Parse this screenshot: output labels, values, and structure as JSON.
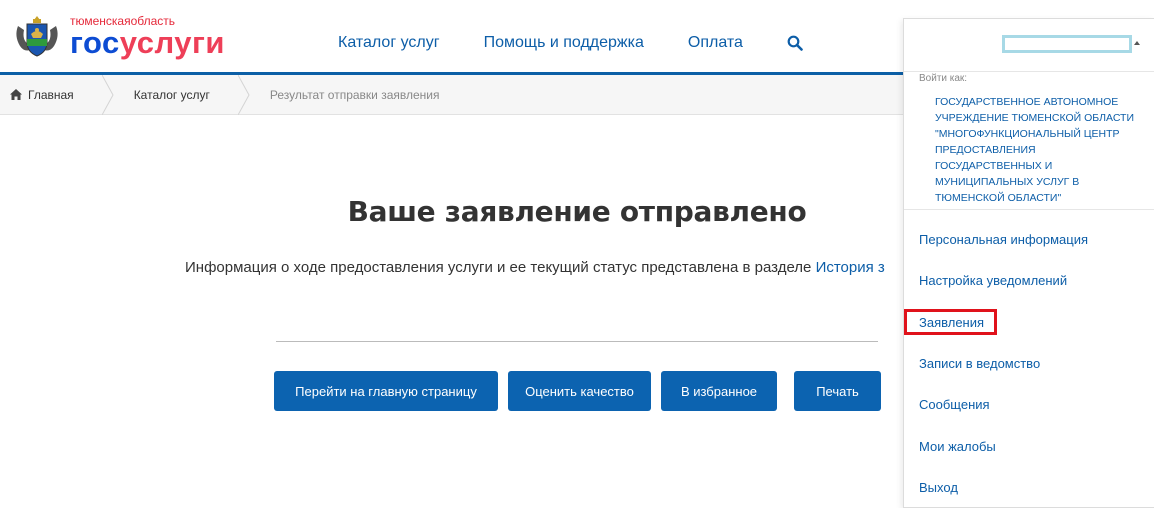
{
  "header": {
    "logo_region": "тюменскаяобласть",
    "logo_region_a": "тюменская",
    "logo_region_b": "область",
    "logo_main_a": "гос",
    "logo_main_b": "услуги",
    "nav": [
      "Каталог услуг",
      "Помощь и поддержка",
      "Оплата"
    ],
    "search_icon": "search-icon"
  },
  "breadcrumb": {
    "home": "Главная",
    "catalog": "Каталог услуг",
    "current": "Результат отправки заявления"
  },
  "main": {
    "title": "Ваше заявление отправлено",
    "info_text": "Информация о ходе предоставления услуги и ее текущий статус представлена в разделе ",
    "info_link": "История з",
    "buttons": {
      "home": "Перейти на главную страницу",
      "rate": "Оценить качество",
      "favorite": "В избранное",
      "print": "Печать"
    }
  },
  "user_menu": {
    "user_name_redacted": "",
    "login_as_label": "Войти как:",
    "organization": "ГОСУДАРСТВЕННОЕ АВТОНОМНОЕ УЧРЕЖДЕНИЕ ТЮМЕНСКОЙ ОБЛАСТИ \"МНОГОФУНКЦИОНАЛЬНЫЙ ЦЕНТР ПРЕДОСТАВЛЕНИЯ ГОСУДАРСТВЕННЫХ И МУНИЦИПАЛЬНЫХ УСЛУГ В ТЮМЕНСКОЙ ОБЛАСТИ\"",
    "items": [
      "Персональная информация",
      "Настройка уведомлений",
      "Заявления",
      "Записи в ведомство",
      "Сообщения",
      "Мои жалобы",
      "Выход"
    ],
    "highlighted_item": "Заявления"
  },
  "colors": {
    "brand_blue": "#0d5ea8",
    "button_blue": "#0c63b0",
    "logo_red": "#ee3f58",
    "highlight_red": "#e0121b"
  }
}
